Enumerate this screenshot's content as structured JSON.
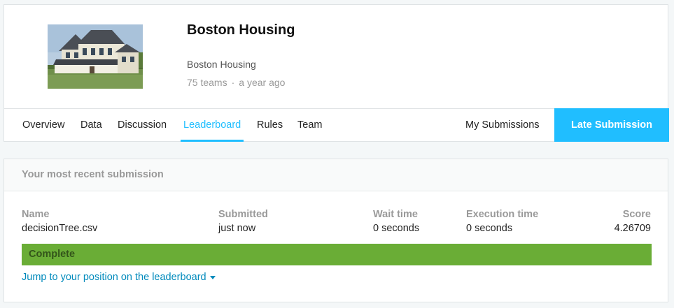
{
  "competition": {
    "title": "Boston Housing",
    "subtitle": "Boston Housing",
    "teams": "75 teams",
    "separator": "·",
    "age": "a year ago"
  },
  "tabs": [
    {
      "label": "Overview"
    },
    {
      "label": "Data"
    },
    {
      "label": "Discussion"
    },
    {
      "label": "Leaderboard",
      "active": true
    },
    {
      "label": "Rules"
    },
    {
      "label": "Team"
    }
  ],
  "actions": {
    "my_submissions": "My Submissions",
    "late_submission": "Late Submission"
  },
  "submission": {
    "heading": "Your most recent submission",
    "columns": {
      "name": {
        "label": "Name",
        "value": "decisionTree.csv"
      },
      "submitted": {
        "label": "Submitted",
        "value": "just now"
      },
      "wait_time": {
        "label": "Wait time",
        "value": "0 seconds"
      },
      "execution_time": {
        "label": "Execution time",
        "value": "0 seconds"
      },
      "score": {
        "label": "Score",
        "value": "4.26709"
      }
    },
    "status": "Complete",
    "jump_link": "Jump to your position on the leaderboard"
  },
  "colors": {
    "accent": "#20beff",
    "status_complete": "#6aad36",
    "link": "#008abc"
  }
}
